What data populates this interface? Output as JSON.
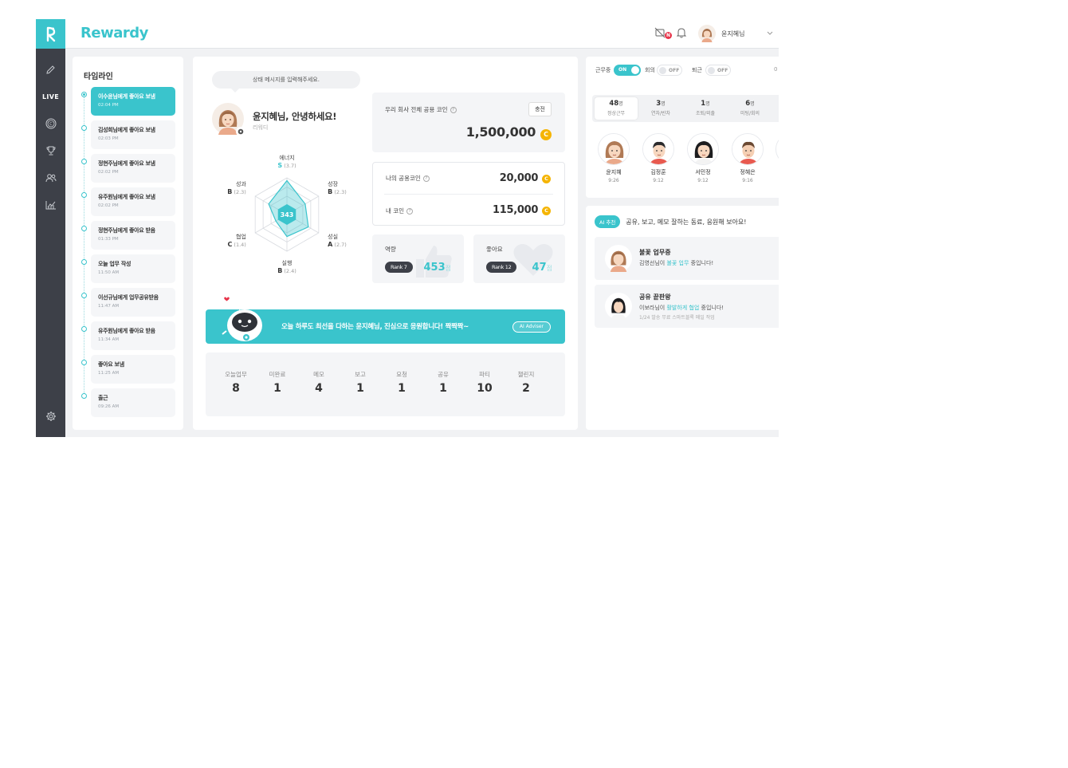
{
  "brand": {
    "name": "Rewardy"
  },
  "rail": {
    "items": [
      {
        "name": "pencil-icon"
      },
      {
        "name": "live-label",
        "label": "LIVE"
      },
      {
        "name": "coin-icon"
      },
      {
        "name": "trophy-icon"
      },
      {
        "name": "people-icon"
      },
      {
        "name": "chart-icon"
      }
    ],
    "settings_icon": "gear-icon"
  },
  "header": {
    "notification_badge": "N",
    "user_name": "윤지혜님"
  },
  "timeline": {
    "title": "타임라인",
    "items": [
      {
        "text": "이수윤님에게 좋아요 보냄",
        "time": "02:04 PM",
        "active": true
      },
      {
        "text": "김성희님에게 좋아요 보냄",
        "time": "02:03 PM"
      },
      {
        "text": "정현주님에게 좋아요 보냄",
        "time": "02:02 PM"
      },
      {
        "text": "유주원님에게 좋아요 보냄",
        "time": "02:02 PM"
      },
      {
        "text": "정현주님에게 좋아요 받음",
        "time": "01:33 PM"
      },
      {
        "text": "오늘 업무 작성",
        "time": "11:50 AM"
      },
      {
        "text": "이선규님에게 업무공유받음",
        "time": "11:47 AM"
      },
      {
        "text": "유주원님에게 좋아요 받음",
        "time": "11:34 AM"
      },
      {
        "text": "좋아요 보냄",
        "time": "11:25 AM"
      },
      {
        "text": "출근",
        "time": "09:26 AM"
      }
    ]
  },
  "profile": {
    "status_placeholder": "상태 메시지를 입력해주세요.",
    "greeting": "윤지혜님, 안녕하세요!",
    "role": "리워디"
  },
  "radar": {
    "center_score": "343",
    "axes": [
      {
        "name": "에너지",
        "grade": "S",
        "score": "(3.7)",
        "value": 3.7
      },
      {
        "name": "성장",
        "grade": "B",
        "score": "(2.3)",
        "value": 2.3
      },
      {
        "name": "성실",
        "grade": "A",
        "score": "(2.7)",
        "value": 2.7
      },
      {
        "name": "실행",
        "grade": "B",
        "score": "(2.4)",
        "value": 2.4
      },
      {
        "name": "협업",
        "grade": "C",
        "score": "(1.4)",
        "value": 1.4
      },
      {
        "name": "성과",
        "grade": "B",
        "score": "(2.3)",
        "value": 2.3
      }
    ]
  },
  "coins": {
    "company_label": "우리 회사 전체 공용 코인",
    "company_value": "1,500,000",
    "charge_label": "충전",
    "my_common_label": "나의 공용코인",
    "my_common_value": "20,000",
    "my_coin_label": "내 코인",
    "my_coin_value": "115,000",
    "coin_symbol": "C"
  },
  "ranks": {
    "ability": {
      "label": "역량",
      "rank": "Rank 7",
      "points": "453",
      "unit": "점"
    },
    "likes": {
      "label": "좋아요",
      "rank": "Rank 12",
      "points": "47",
      "unit": "점"
    }
  },
  "banner": {
    "message": "오늘 하루도 최선을 다하는 윤지혜님, 진심으로 응원합니다! 짝짝짝~",
    "button": "AI Adviser"
  },
  "stats": [
    {
      "label": "오늘업무",
      "value": "8"
    },
    {
      "label": "미완료",
      "value": "1"
    },
    {
      "label": "메모",
      "value": "4"
    },
    {
      "label": "보고",
      "value": "1"
    },
    {
      "label": "요청",
      "value": "1"
    },
    {
      "label": "공유",
      "value": "1"
    },
    {
      "label": "파티",
      "value": "10"
    },
    {
      "label": "챌린지",
      "value": "2"
    }
  ],
  "status_toggles": [
    {
      "label": "근무중",
      "state": "ON"
    },
    {
      "label": "회의",
      "state": "OFF"
    },
    {
      "label": "퇴근",
      "state": "OFF"
    }
  ],
  "status_overflow": "0",
  "attendance": [
    {
      "count": "48",
      "unit": "명",
      "label": "정상근무"
    },
    {
      "count": "3",
      "unit": "명",
      "label": "연차/반차"
    },
    {
      "count": "1",
      "unit": "명",
      "label": "조퇴/외출"
    },
    {
      "count": "6",
      "unit": "명",
      "label": "미팅/회의"
    }
  ],
  "colleagues": [
    {
      "name": "윤지혜",
      "time": "9:26"
    },
    {
      "name": "김정훈",
      "time": "9:12"
    },
    {
      "name": "서민정",
      "time": "9:12"
    },
    {
      "name": "정혜은",
      "time": "9:16"
    }
  ],
  "ai": {
    "badge": "AI 추천",
    "headline": "공유, 보고, 메모 잘하는 동료, 응원해 보아요!",
    "recs": [
      {
        "title": "불꽃 업무중",
        "desc_pre": "김영선님이 ",
        "desc_hl": "불꽃 업무",
        "desc_post": " 중입니다!",
        "sub": ""
      },
      {
        "title": "공유 끝판왕",
        "desc_pre": "이보라님이 ",
        "desc_hl": "활발하게 협업",
        "desc_post": " 중입니다!",
        "sub": "1/24 발송 무료 스마트블록 메일 작업"
      }
    ]
  },
  "colors": {
    "accent": "#3ac4cc",
    "rail": "#3d4048",
    "coin": "#f5b400",
    "alert": "#e7344a"
  }
}
